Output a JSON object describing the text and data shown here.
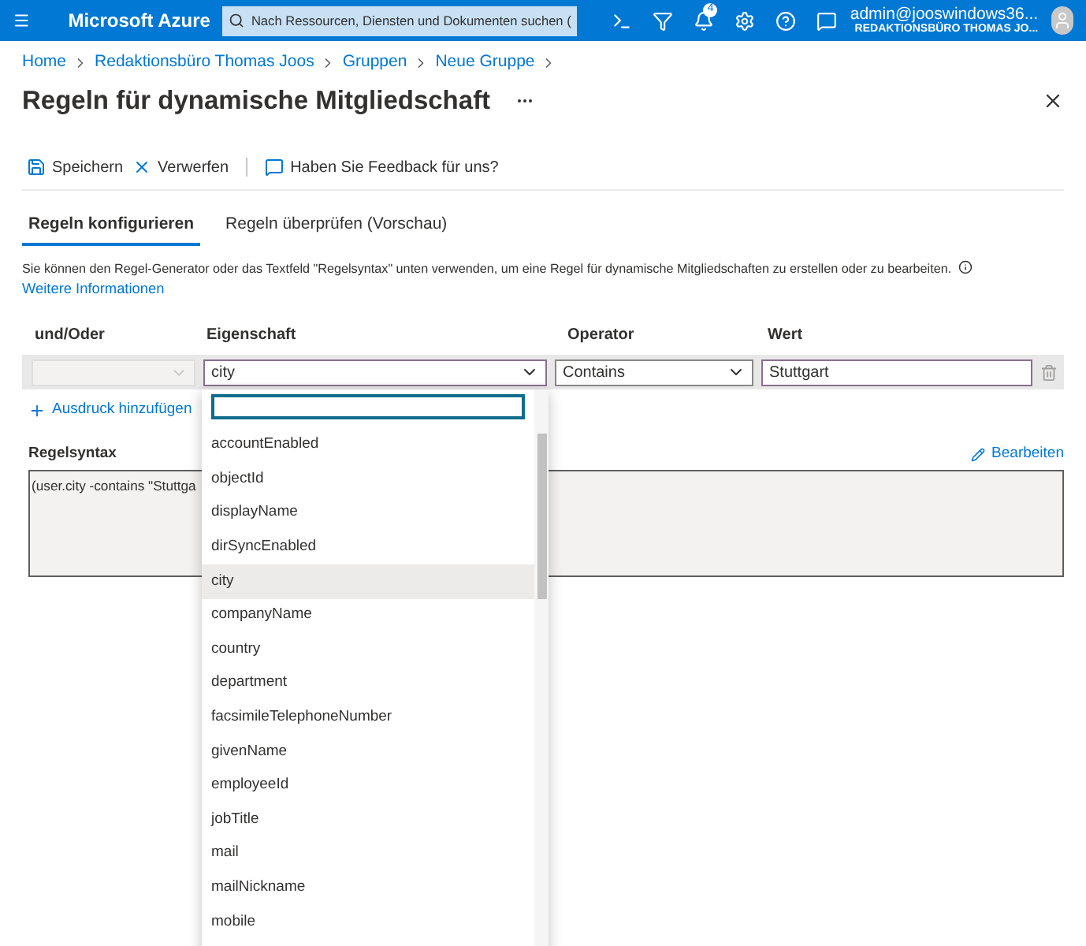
{
  "topbar": {
    "brand": "Microsoft Azure",
    "search_placeholder": "Nach Ressourcen, Diensten und Dokumenten suchen (",
    "notification_count": "4",
    "account": "admin@jooswindows36...",
    "tenant": "REDAKTIONSBÜRO THOMAS JO..."
  },
  "breadcrumb": [
    "Home",
    "Redaktionsbüro Thomas Joos",
    "Gruppen",
    "Neue Gruppe"
  ],
  "title": "Regeln für dynamische Mitgliedschaft",
  "toolbar": [
    {
      "kind": "save",
      "label": "Speichern"
    },
    {
      "kind": "discard",
      "label": "Verwerfen"
    },
    {
      "kind": "feedback",
      "label": "Haben Sie Feedback für uns?"
    }
  ],
  "tabs": [
    {
      "label": "Regeln konfigurieren",
      "selected": true
    },
    {
      "label": "Regeln überprüfen (Vorschau)",
      "selected": false
    }
  ],
  "description": "Sie können den Regel-Generator oder das Textfeld \"Regelsyntax\" unten verwenden, um eine Regel für dynamische Mitgliedschaften zu erstellen oder zu bearbeiten.",
  "more_info": "Weitere Informationen",
  "columns": [
    "und/Oder",
    "Eigenschaft",
    "Operator",
    "Wert"
  ],
  "rule": {
    "property": "city",
    "operator": "Contains",
    "value": "Stuttgart"
  },
  "add_expression": "Ausdruck hinzufügen",
  "syntax": {
    "label": "Regelsyntax",
    "edit": "Bearbeiten",
    "text": "(user.city -contains \"Stuttga"
  },
  "dropdown": {
    "options": [
      {
        "label": "accountEnabled",
        "selected": false
      },
      {
        "label": "objectId",
        "selected": false
      },
      {
        "label": "displayName",
        "selected": false
      },
      {
        "label": "dirSyncEnabled",
        "selected": false
      },
      {
        "label": "city",
        "selected": true
      },
      {
        "label": "companyName",
        "selected": false
      },
      {
        "label": "country",
        "selected": false
      },
      {
        "label": "department",
        "selected": false
      },
      {
        "label": "facsimileTelephoneNumber",
        "selected": false
      },
      {
        "label": "givenName",
        "selected": false
      },
      {
        "label": "employeeId",
        "selected": false
      },
      {
        "label": "jobTitle",
        "selected": false
      },
      {
        "label": "mail",
        "selected": false
      },
      {
        "label": "mailNickname",
        "selected": false
      },
      {
        "label": "mobile",
        "selected": false
      }
    ]
  }
}
